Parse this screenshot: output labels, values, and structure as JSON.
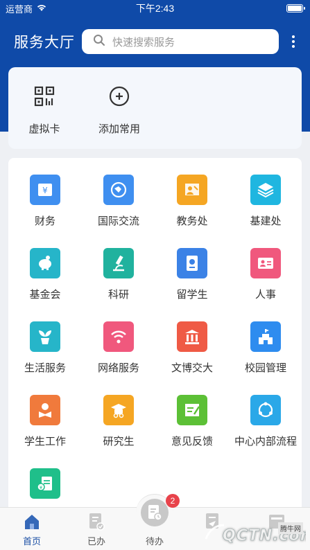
{
  "status_bar": {
    "carrier": "运营商",
    "time": "下午2:43",
    "battery_level": 1.0
  },
  "header": {
    "title": "服务大厅",
    "search_placeholder": "快速搜索服务"
  },
  "quick_actions": [
    {
      "label": "虚拟卡",
      "icon": "qr-code-icon"
    },
    {
      "label": "添加常用",
      "icon": "add-circle-icon"
    }
  ],
  "services": [
    {
      "label": "财务",
      "icon": "finance-icon",
      "color": "#3f8ff0"
    },
    {
      "label": "国际交流",
      "icon": "globe-icon",
      "color": "#3f8ff0"
    },
    {
      "label": "教务处",
      "icon": "teaching-icon",
      "color": "#f5a623"
    },
    {
      "label": "基建处",
      "icon": "layers-icon",
      "color": "#1fb6e0"
    },
    {
      "label": "基金会",
      "icon": "piggy-bank-icon",
      "color": "#26b5c9"
    },
    {
      "label": "科研",
      "icon": "microscope-icon",
      "color": "#20b29e"
    },
    {
      "label": "留学生",
      "icon": "passport-icon",
      "color": "#3b82e6"
    },
    {
      "label": "人事",
      "icon": "id-card-icon",
      "color": "#f0587d"
    },
    {
      "label": "生活服务",
      "icon": "plant-icon",
      "color": "#26b5c9"
    },
    {
      "label": "网络服务",
      "icon": "wifi-icon",
      "color": "#f0587d"
    },
    {
      "label": "文博交大",
      "icon": "museum-icon",
      "color": "#ef5a45"
    },
    {
      "label": "校园管理",
      "icon": "campus-icon",
      "color": "#2e8cef"
    },
    {
      "label": "学生工作",
      "icon": "student-icon",
      "color": "#f07a3c"
    },
    {
      "label": "研究生",
      "icon": "graduate-icon",
      "color": "#f5a623"
    },
    {
      "label": "意见反馈",
      "icon": "feedback-icon",
      "color": "#5cc036"
    },
    {
      "label": "中心内部流程",
      "icon": "process-icon",
      "color": "#2aa8e8"
    },
    {
      "label": "",
      "icon": "receipt-icon",
      "color": "#1fbf8a"
    }
  ],
  "tabs": [
    {
      "label": "首页",
      "icon": "home-icon",
      "active": true
    },
    {
      "label": "已办",
      "icon": "done-doc-icon",
      "active": false
    },
    {
      "label": "待办",
      "icon": "todo-icon",
      "active": false,
      "badge": "2"
    },
    {
      "label": "",
      "icon": "send-doc-icon",
      "active": false
    },
    {
      "label": "",
      "icon": "profile-icon",
      "active": false
    }
  ],
  "watermark": {
    "logo_text": "QCTN.com",
    "small_text": "腾牛网"
  }
}
